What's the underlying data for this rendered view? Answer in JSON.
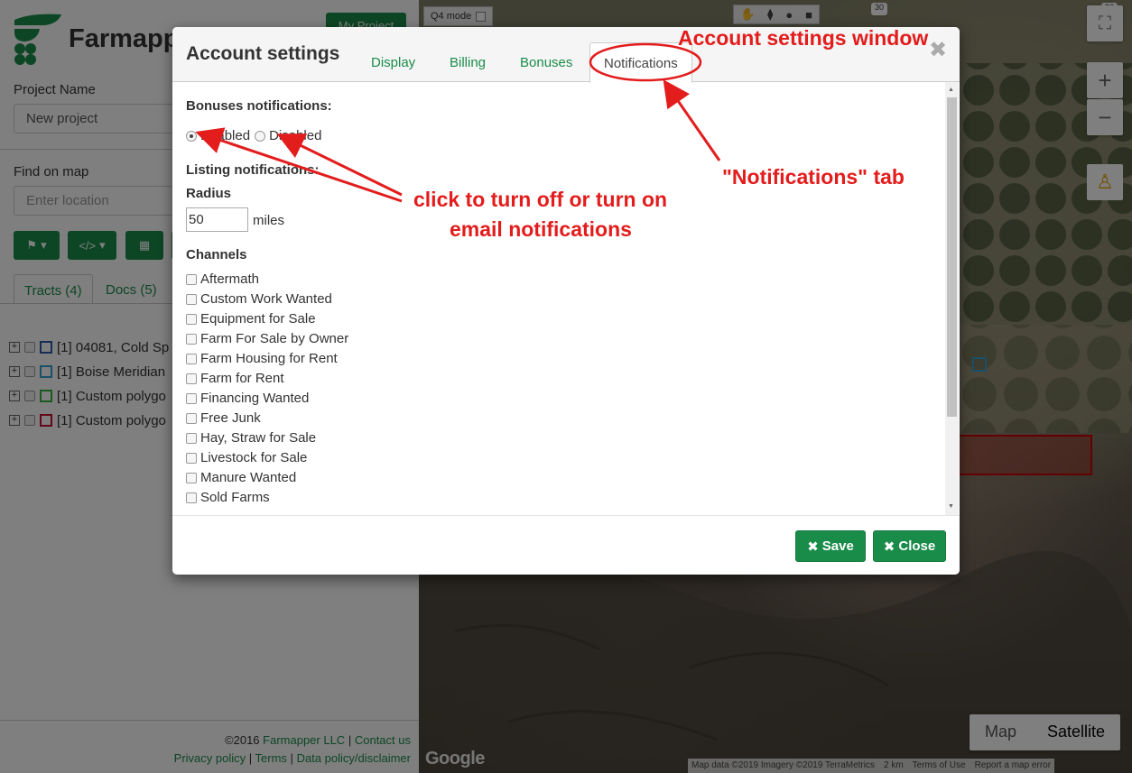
{
  "sidebar": {
    "brand": "Farmapper",
    "project_button": "My Project",
    "project_name_label": "Project Name",
    "project_name_value": "New project",
    "find_label": "Find on map",
    "find_placeholder": "Enter location",
    "tabs": [
      {
        "label": "Tracts (4)"
      },
      {
        "label": "Docs  (5)"
      }
    ],
    "tracts": [
      {
        "label": "[1] 04081, Cold Sp",
        "color": "#2c5da8"
      },
      {
        "label": "[1] Boise Meridian",
        "color": "#33a0d0"
      },
      {
        "label": "[1] Custom polygo",
        "color": "#3ab03a"
      },
      {
        "label": "[1] Custom polygo",
        "color": "#c8102e"
      }
    ],
    "footer": {
      "copyright": "©2016",
      "company": "Farmapper LLC",
      "sep": "|",
      "contact": "Contact us",
      "privacy": "Privacy policy",
      "terms": "Terms",
      "data_policy": "Data policy/disclaimer"
    }
  },
  "map": {
    "q4_label": "Q4 mode",
    "road_30": "30",
    "map_label": "Map",
    "satellite_label": "Satellite",
    "google": "Google",
    "attribution": "Map data ©2019 Imagery ©2019 TerraMetrics",
    "scale": "2 km",
    "terms_of_use": "Terms of Use",
    "report": "Report a map error"
  },
  "modal": {
    "title": "Account settings",
    "tabs": [
      {
        "label": "Display"
      },
      {
        "label": "Billing"
      },
      {
        "label": "Bonuses"
      },
      {
        "label": "Notifications"
      }
    ],
    "bonuses_label": "Bonuses notifications:",
    "enabled_label": "Enabled",
    "disabled_label": "Disabled",
    "listing_label": "Listing notifications:",
    "radius_label": "Radius",
    "radius_value": "50",
    "miles_label": "miles",
    "channels_label": "Channels",
    "channels": [
      "Aftermath",
      "Custom Work Wanted",
      "Equipment for Sale",
      "Farm For Sale by Owner",
      "Farm Housing for Rent",
      "Farm for Rent",
      "Financing Wanted",
      "Free Junk",
      "Hay, Straw for Sale",
      "Livestock for Sale",
      "Manure Wanted",
      "Sold Farms"
    ],
    "save_label": "Save",
    "close_label": "Close"
  },
  "annotations": {
    "window": "Account settings window",
    "tab": "\"Notifications\" tab",
    "click_line1": "click to turn off or turn on",
    "click_line2": "email notifications"
  },
  "colors": {
    "brand_green": "#1a8c4a",
    "annotation_red": "#e31c1c"
  }
}
